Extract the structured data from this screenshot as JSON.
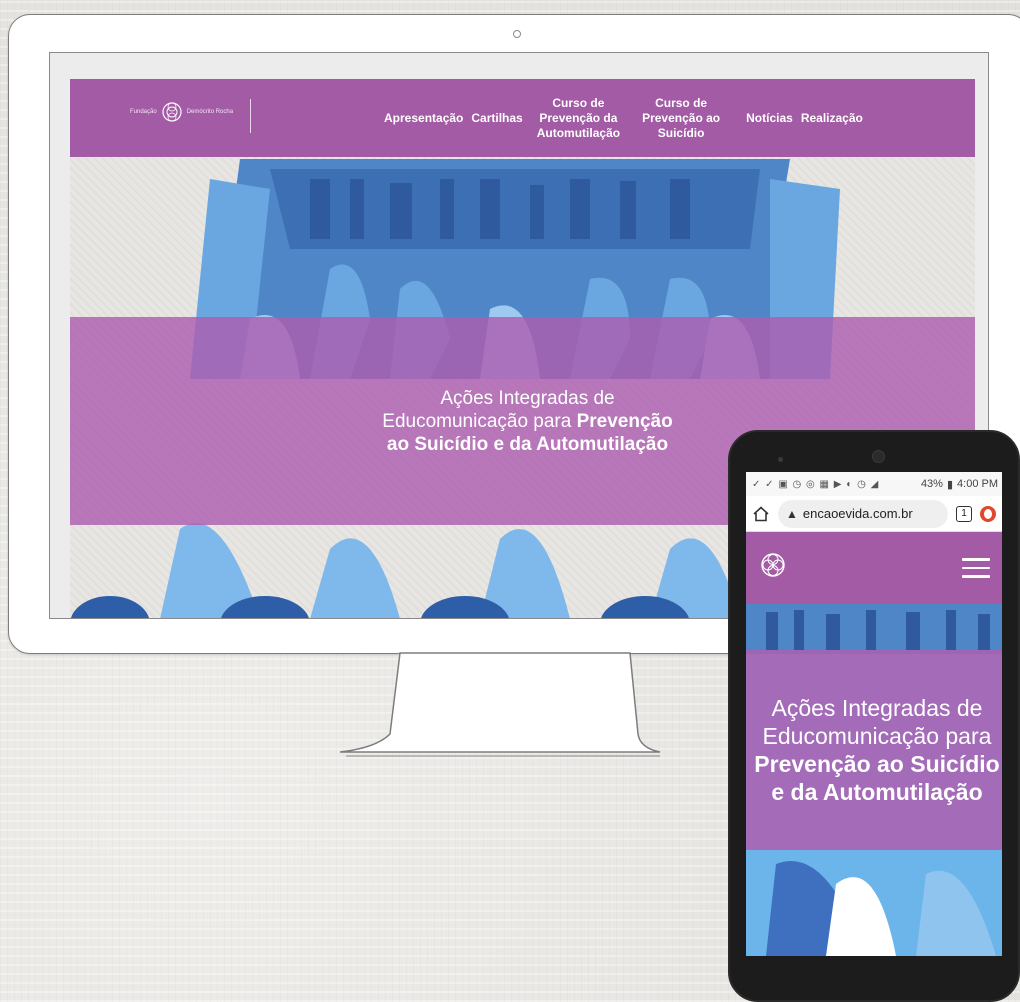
{
  "desktop": {
    "logo": {
      "prefix": "Fundação",
      "name": "Demócrito Rocha"
    },
    "nav": [
      {
        "l1": "Apresentação",
        "l2": "",
        "l3": ""
      },
      {
        "l1": "Cartilhas",
        "l2": "",
        "l3": ""
      },
      {
        "l1": "Curso de",
        "l2": "Prevenção da",
        "l3": "Automutilação"
      },
      {
        "l1": "Curso de",
        "l2": "Prevenção ao",
        "l3": "Suicídio"
      },
      {
        "l1": "Notícias",
        "l2": "",
        "l3": ""
      },
      {
        "l1": "Realização",
        "l2": "",
        "l3": ""
      }
    ],
    "hero": {
      "line1": "Ações Integradas de",
      "line2_regular": "Educomunicação para ",
      "line2_bold": "Prevenção",
      "line3_bold": "ao Suicídio e da Automutilação"
    }
  },
  "mobile": {
    "status": {
      "icons": "✓ ✓ ▣ ◷ ◎ ▦ ▶  ◐ ◷ ◢",
      "battery": "43%",
      "time": "4:00 PM"
    },
    "url": "encaoevida.com.br",
    "tabs": "1",
    "hero": {
      "line1": "Ações Integradas de",
      "line2": "Educomunicação para",
      "line3_bold": "Prevenção ao Suicídio",
      "line4_bold": "e da Automutilação"
    }
  },
  "colors": {
    "brand_purple": "#a35ba5",
    "hero_blue": "#6bb5ea",
    "dark_blue": "#3f6fbf"
  }
}
